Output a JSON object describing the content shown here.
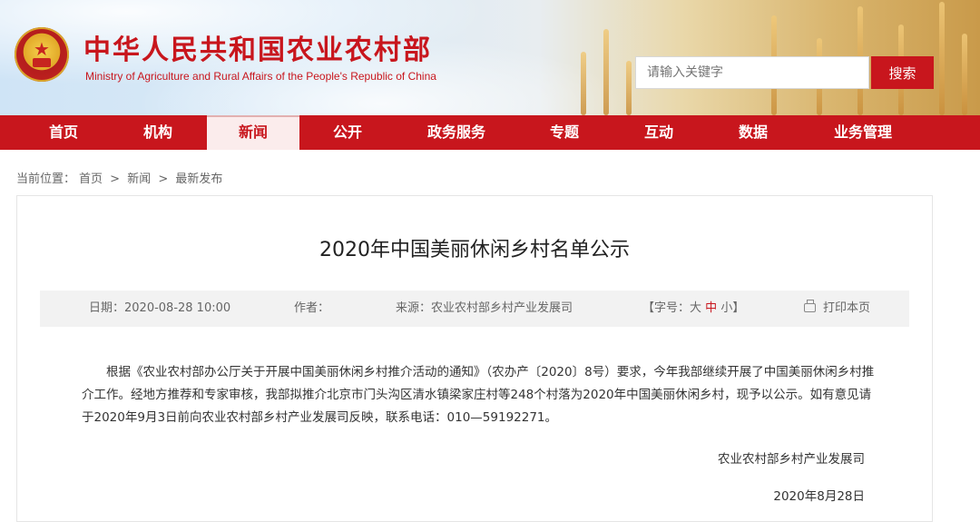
{
  "header": {
    "title": "中华人民共和国农业农村部",
    "subtitle": "Ministry of Agriculture and Rural Affairs of the People's Republic of China",
    "search_placeholder": "请输入关键字",
    "search_button": "搜索",
    "emblem_icon": "national-emblem-icon",
    "brand_color": "#c8161d"
  },
  "nav": {
    "items": [
      {
        "label": "首页"
      },
      {
        "label": "机构"
      },
      {
        "label": "新闻"
      },
      {
        "label": "公开"
      },
      {
        "label": "政务服务"
      },
      {
        "label": "专题"
      },
      {
        "label": "互动"
      },
      {
        "label": "数据"
      },
      {
        "label": "业务管理"
      }
    ],
    "active_label": "新闻"
  },
  "breadcrumb": {
    "prefix": "当前位置：",
    "items": [
      "首页",
      "新闻",
      "最新发布"
    ],
    "separator": ">"
  },
  "article": {
    "title": "2020年中国美丽休闲乡村名单公示",
    "meta": {
      "date": "日期：2020-08-28 10:00",
      "author": "作者：",
      "source": "来源：农业农村部乡村产业发展司",
      "font_label": "【字号：",
      "font_large": "大",
      "font_medium": "中",
      "font_small": "小",
      "font_end": "】",
      "print": "打印本页",
      "print_icon": "printer-icon"
    },
    "body": "根据《农业农村部办公厅关于开展中国美丽休闲乡村推介活动的通知》（农办产〔2020〕8号）要求，今年我部继续开展了中国美丽休闲乡村推介工作。经地方推荐和专家审核，我部拟推介北京市门头沟区清水镇梁家庄村等248个村落为2020年中国美丽休闲乡村，现予以公示。如有意见请于2020年9月3日前向农业农村部乡村产业发展司反映，联系电话：010—59192271。",
    "signature": "农业农村部乡村产业发展司",
    "date": "2020年8月28日"
  }
}
